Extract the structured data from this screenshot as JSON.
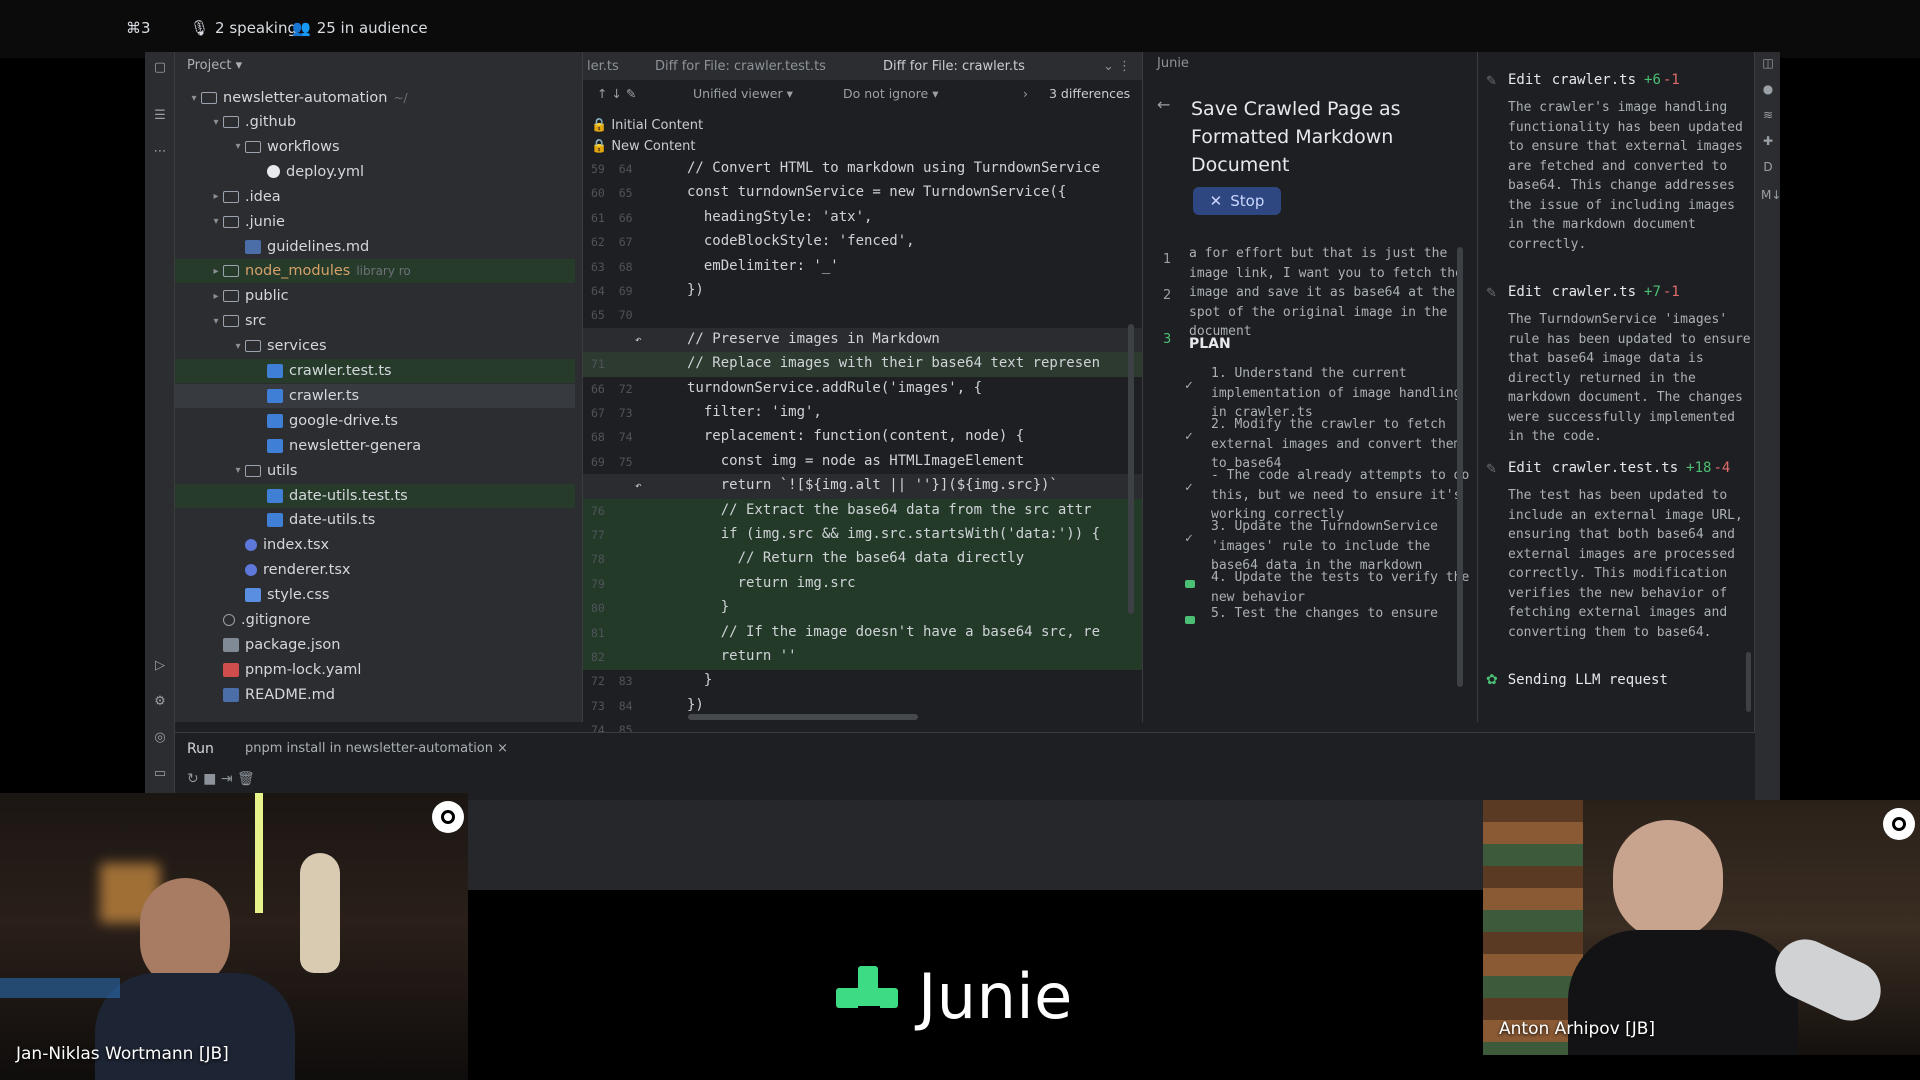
{
  "stream": {
    "shortcut": "⌘3",
    "speaking": "2 speaking",
    "audience": "25 in audience"
  },
  "project": {
    "header": "Project",
    "root": "newsletter-automation",
    "tree": [
      {
        "label": ".github",
        "kind": "folder",
        "depth": 1,
        "open": true
      },
      {
        "label": "workflows",
        "kind": "folder",
        "depth": 2,
        "open": true
      },
      {
        "label": "deploy.yml",
        "kind": "gh",
        "depth": 3
      },
      {
        "label": ".idea",
        "kind": "folder",
        "depth": 1,
        "open": false
      },
      {
        "label": ".junie",
        "kind": "folder",
        "depth": 1,
        "open": true
      },
      {
        "label": "guidelines.md",
        "kind": "md",
        "depth": 2
      },
      {
        "label": "node_modules",
        "kind": "folder",
        "depth": 1,
        "open": false,
        "note": "library ro",
        "style": "changed"
      },
      {
        "label": "public",
        "kind": "folder",
        "depth": 1,
        "open": false
      },
      {
        "label": "src",
        "kind": "folder",
        "depth": 1,
        "open": true
      },
      {
        "label": "services",
        "kind": "folder",
        "depth": 2,
        "open": true
      },
      {
        "label": "crawler.test.ts",
        "kind": "ts",
        "depth": 3,
        "style": "changed"
      },
      {
        "label": "crawler.ts",
        "kind": "ts",
        "depth": 3,
        "style": "sel"
      },
      {
        "label": "google-drive.ts",
        "kind": "ts",
        "depth": 3
      },
      {
        "label": "newsletter-genera",
        "kind": "ts",
        "depth": 3
      },
      {
        "label": "utils",
        "kind": "folder",
        "depth": 2,
        "open": true
      },
      {
        "label": "date-utils.test.ts",
        "kind": "ts",
        "depth": 3,
        "style": "changed"
      },
      {
        "label": "date-utils.ts",
        "kind": "ts",
        "depth": 3
      },
      {
        "label": "index.tsx",
        "kind": "tsx",
        "depth": 2
      },
      {
        "label": "renderer.tsx",
        "kind": "tsx",
        "depth": 2
      },
      {
        "label": "style.css",
        "kind": "css",
        "depth": 2
      },
      {
        "label": ".gitignore",
        "kind": "git",
        "depth": 1
      },
      {
        "label": "package.json",
        "kind": "json",
        "depth": 1
      },
      {
        "label": "pnpm-lock.yaml",
        "kind": "yml",
        "depth": 1
      },
      {
        "label": "README.md",
        "kind": "md",
        "depth": 1
      }
    ]
  },
  "editor": {
    "tabs": [
      "ler.ts",
      "Diff for File: crawler.test.ts",
      "Diff for File: crawler.ts"
    ],
    "viewer": "Unified viewer",
    "ignore": "Do not ignore",
    "differences": "3 differences",
    "initial_content": "Initial Content",
    "new_content": "New Content",
    "lines": [
      {
        "ln": "59  64",
        "text": "// Convert HTML to markdown using TurndownService",
        "type": "cmt"
      },
      {
        "ln": "60  65",
        "text": "const turndownService = new TurndownService({",
        "type": "code"
      },
      {
        "ln": "61  66",
        "text": "  headingStyle: 'atx',",
        "type": "code"
      },
      {
        "ln": "62  67",
        "text": "  codeBlockStyle: 'fenced',",
        "type": "code"
      },
      {
        "ln": "63  68",
        "text": "  emDelimiter: '_'",
        "type": "code"
      },
      {
        "ln": "64  69",
        "text": "})",
        "type": "code"
      },
      {
        "ln": "65  70",
        "text": "",
        "type": "code"
      },
      {
        "ln": "",
        "text": "// Preserve images in Markdown",
        "type": "grey"
      },
      {
        "ln": "71",
        "text": "// Replace images with their base64 text represen",
        "type": "modhead"
      },
      {
        "ln": "66  72",
        "text": "turndownService.addRule('images', {",
        "type": "code"
      },
      {
        "ln": "67  73",
        "text": "  filter: 'img',",
        "type": "code"
      },
      {
        "ln": "68  74",
        "text": "  replacement: function(content, node) {",
        "type": "code"
      },
      {
        "ln": "69  75",
        "text": "    const img = node as HTMLImageElement",
        "type": "code"
      },
      {
        "ln": "",
        "text": "    return `![${img.alt || ''}](${img.src})`",
        "type": "grey"
      },
      {
        "ln": "76",
        "text": "    // Extract the base64 data from the src attr",
        "type": "mod"
      },
      {
        "ln": "77",
        "text": "    if (img.src && img.src.startsWith('data:')) {",
        "type": "mod"
      },
      {
        "ln": "78",
        "text": "      // Return the base64 data directly",
        "type": "mod"
      },
      {
        "ln": "79",
        "text": "      return img.src",
        "type": "mod"
      },
      {
        "ln": "80",
        "text": "    }",
        "type": "mod"
      },
      {
        "ln": "81",
        "text": "    // If the image doesn't have a base64 src, re",
        "type": "mod"
      },
      {
        "ln": "82",
        "text": "    return ''",
        "type": "mod"
      },
      {
        "ln": "72  83",
        "text": "  }",
        "type": "code"
      },
      {
        "ln": "73  84",
        "text": "})",
        "type": "code"
      },
      {
        "ln": "74  85",
        "text": "",
        "type": "code"
      }
    ]
  },
  "junie": {
    "panel": "Junie",
    "title": "Save Crawled Page as Formatted Markdown Document",
    "stop": "Stop",
    "prompt": "a for effort but that is just the image link, I want you to fetch the image and save it as base64 at the spot of the original image in the document",
    "plan_label": "PLAN",
    "plan": [
      {
        "text": "1. Understand the current implementation of image handling in crawler.ts",
        "status": "done"
      },
      {
        "text": "2. Modify the crawler to fetch external images and convert them to base64",
        "status": "done"
      },
      {
        "text": "- The code already attempts to do this, but we need to ensure it's working correctly",
        "status": "done"
      },
      {
        "text": "3. Update the TurndownService 'images' rule to include the base64 data in the markdown",
        "status": "done"
      },
      {
        "text": "4. Update the tests to verify the new behavior",
        "status": "pending"
      },
      {
        "text": "5. Test the changes to ensure",
        "status": "pending"
      }
    ]
  },
  "edits": [
    {
      "file": "crawler.ts",
      "add": "+6",
      "del": "-1",
      "desc": "The crawler's image handling functionality has been updated to ensure that external images are fetched and converted to base64. This change addresses the issue of including images in the markdown document correctly."
    },
    {
      "file": "crawler.ts",
      "add": "+7",
      "del": "-1",
      "desc": "The TurndownService 'images' rule has been updated to ensure that base64 image data is directly returned in the markdown document. The changes were successfully implemented in the code."
    },
    {
      "file": "crawler.test.ts",
      "add": "+18",
      "del": "-4",
      "desc": "The test has been updated to include an external image URL, ensuring that both base64 and external images are processed correctly. This modification verifies the new behavior of fetching external images and converting them to base64."
    }
  ],
  "edit_label": "Edit",
  "sending": "Sending LLM request",
  "run": {
    "label": "Run",
    "task": "pnpm install in newsletter-automation"
  },
  "cams": {
    "left_name": "Jan-Niklas Wortmann [JB]",
    "right_name": "Anton Arhipov [JB]"
  },
  "brand": {
    "name": "Junie",
    "accent": "#3ddc84"
  }
}
